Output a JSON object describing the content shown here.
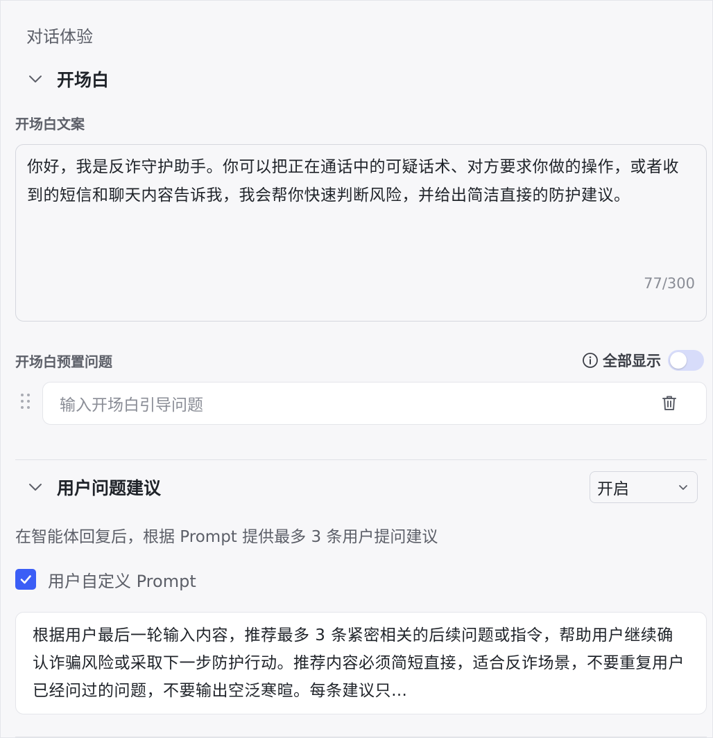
{
  "section": {
    "title": "对话体验"
  },
  "opening": {
    "header_title": "开场白",
    "text_label": "开场白文案",
    "text_value": "你好，我是反诈守护助手。你可以把正在通话中的可疑话术、对方要求你做的操作，或者收到的短信和聊天内容告诉我，我会帮你快速判断风险，并给出简洁直接的防护建议。",
    "counter": "77/300",
    "preset_label": "开场白预置问题",
    "show_all_label": "全部显示",
    "show_all_enabled": false,
    "question_placeholder": "输入开场白引导问题"
  },
  "suggestions": {
    "header_title": "用户问题建议",
    "select_value": "开启",
    "description": "在智能体回复后，根据 Prompt 提供最多 3 条用户提问建议",
    "custom_prompt_label": "用户自定义 Prompt",
    "custom_prompt_checked": true,
    "prompt_text": "根据用户最后一轮输入内容，推荐最多 3 条紧密相关的后续问题或指令，帮助用户继续确认诈骗风险或采取下一步防护行动。推荐内容必须简短直接，适合反诈场景，不要重复用户已经问过的问题，不要输出空泛寒暄。每条建议只…"
  },
  "colors": {
    "accent": "#3b5ef6",
    "toggle_off": "#d7dcfa",
    "background": "#f7f7f9"
  },
  "icons": {
    "opening_chevron": "chevron-down-icon",
    "suggestions_chevron": "chevron-down-icon",
    "info": "info-icon",
    "drag": "drag-handle-icon",
    "delete": "trash-icon",
    "select_arrow": "chevron-down-icon",
    "check": "check-icon"
  }
}
